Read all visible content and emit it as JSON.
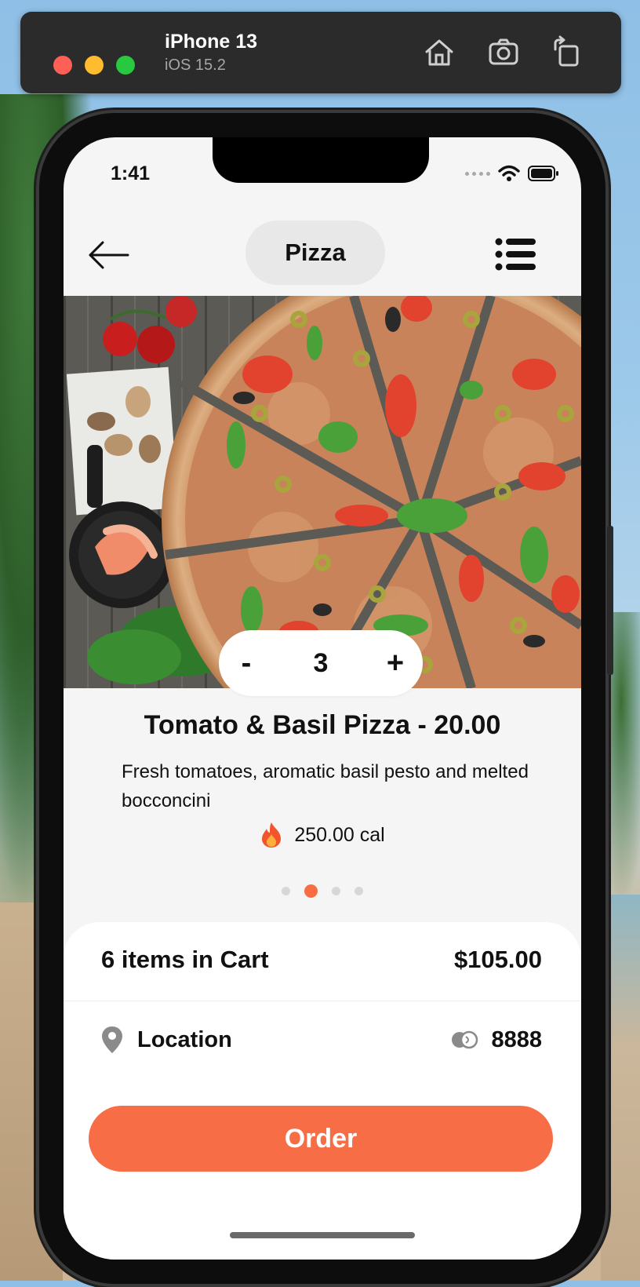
{
  "simulator": {
    "device": "iPhone 13",
    "os": "iOS 15.2",
    "tools": [
      "home-icon",
      "screenshot-icon",
      "rotate-icon"
    ]
  },
  "status_bar": {
    "time": "1:41",
    "icons": [
      "cellular-icon",
      "wifi-icon",
      "battery-icon"
    ]
  },
  "header": {
    "title": "Pizza",
    "back_icon": "arrow-left-icon",
    "menu_icon": "list-menu-icon"
  },
  "product": {
    "image_alt": "Tomato & Basil Pizza",
    "quantity": "3",
    "decrement_label": "-",
    "increment_label": "+",
    "title": "Tomato & Basil Pizza - 20.00",
    "description": "Fresh tomatoes, aromatic basil pesto and melted bocconcini",
    "calories": "250.00 cal",
    "calories_icon": "flame-icon"
  },
  "pagination": {
    "count": 4,
    "active_index": 1
  },
  "cart": {
    "summary": "6 items in Cart",
    "total": "$105.00",
    "location_label": "Location",
    "location_icon": "map-pin-icon",
    "points_icon": "coins-icon",
    "points": "8888",
    "order_label": "Order"
  },
  "colors": {
    "accent": "#f76e46",
    "background": "#f5f5f5",
    "panel": "#ffffff",
    "text": "#111111"
  }
}
